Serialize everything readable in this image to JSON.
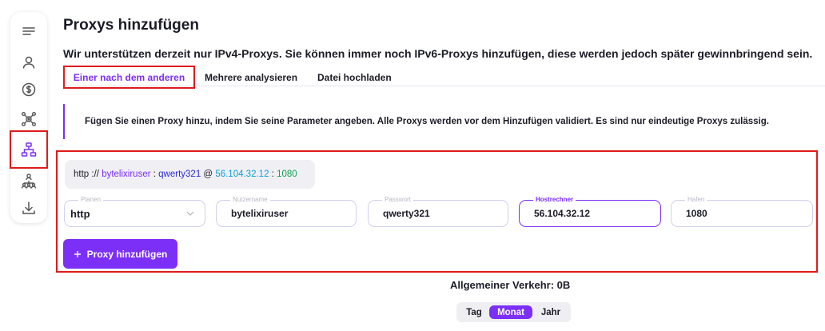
{
  "page": {
    "title": "Proxys hinzufügen",
    "subtitle": "Wir unterstützen derzeit nur IPv4-Proxys. Sie können immer noch IPv6-Proxys hinzufügen, diese werden jedoch später gewinnbringend sein."
  },
  "sidebar": {
    "items": [
      {
        "icon": "menu-icon"
      },
      {
        "icon": "user-icon"
      },
      {
        "icon": "dollar-icon"
      },
      {
        "icon": "network-icon"
      },
      {
        "icon": "sitemap-icon",
        "active": true
      },
      {
        "icon": "team-icon"
      },
      {
        "icon": "download-icon"
      }
    ]
  },
  "tabs": [
    {
      "label": "Einer nach dem anderen",
      "active": true
    },
    {
      "label": "Mehrere analysieren"
    },
    {
      "label": "Datei hochladen"
    }
  ],
  "notice": "Fügen Sie einen Proxy hinzu, indem Sie seine Parameter angeben. Alle Proxys werden vor dem Hinzufügen validiert. Es sind nur eindeutige Proxys zulässig.",
  "preview": {
    "scheme": "http",
    "sep1": "://",
    "user": "bytelixiruser",
    "colon1": ":",
    "password": "qwerty321",
    "at": "@",
    "host": "56.104.32.12",
    "colon2": ":",
    "port": "1080"
  },
  "form": {
    "scheme": {
      "label": "Planen",
      "value": "http"
    },
    "username": {
      "label": "Nutzername",
      "value": "bytelixiruser"
    },
    "password": {
      "label": "Passwort",
      "value": "qwerty321"
    },
    "host": {
      "label": "Hostrechner",
      "value": "56.104.32.12"
    },
    "port": {
      "label": "Hafen",
      "value": "1080"
    },
    "add_button": "Proxy hinzufügen",
    "add_button_icon": "plus-icon"
  },
  "traffic": {
    "label": "Allgemeiner Verkehr: 0B",
    "periods": [
      {
        "label": "Tag"
      },
      {
        "label": "Monat",
        "active": true
      },
      {
        "label": "Jahr"
      }
    ]
  },
  "colors": {
    "accent": "#7b2ff7",
    "highlight_border": "#e01b1b"
  }
}
